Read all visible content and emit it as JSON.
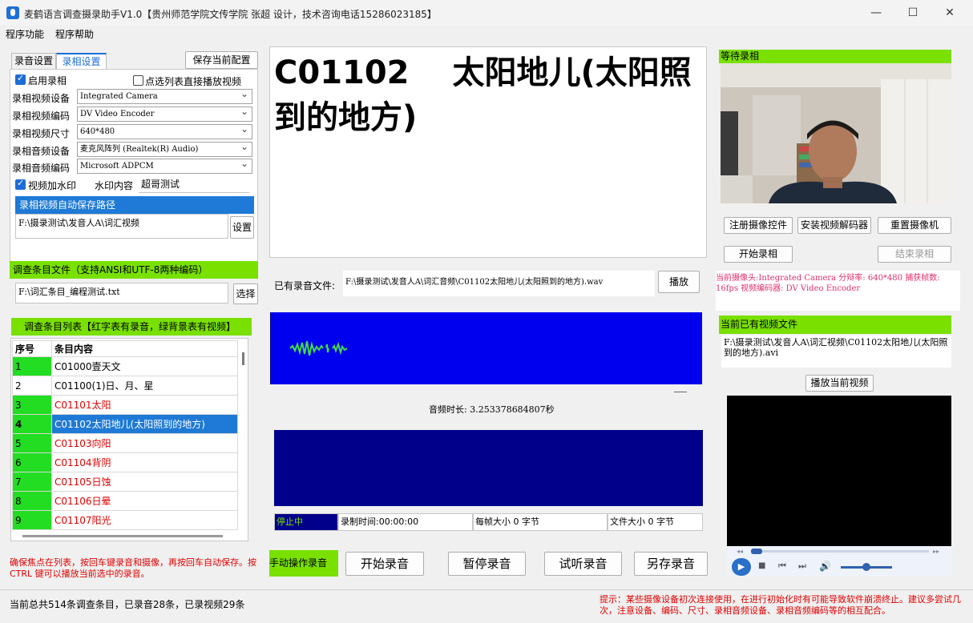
{
  "window": {
    "title": "麦鹤语言调查摄录助手V1.0【贵州师范学院文传学院 张超 设计，技术咨询电话15286023185】",
    "minimize": "—",
    "maximize": "☐",
    "close": "✕"
  },
  "menu": [
    "程序功能",
    "程序帮助"
  ],
  "left": {
    "tabs": [
      "录音设置",
      "录相设置"
    ],
    "active_tab": "录相设置",
    "save_config": "保存当前配置",
    "enable_video": "启用录相",
    "click_play": "点选列表直接播放视频",
    "settings": [
      {
        "label": "录相视频设备",
        "value": "Integrated Camera"
      },
      {
        "label": "录相视频编码",
        "value": "DV Video Encoder"
      },
      {
        "label": "录相视频尺寸",
        "value": "640*480"
      },
      {
        "label": "录相音频设备",
        "value": "麦克风阵列 (Realtek(R) Audio)"
      },
      {
        "label": "录相音频编码",
        "value": "Microsoft ADPCM"
      }
    ],
    "watermark_check": "视频加水印",
    "watermark_label": "水印内容",
    "watermark_value": "超哥测试",
    "save_path_header": "录相视频自动保存路径",
    "save_path": "F:\\摄录测试\\发音人A\\词汇视频",
    "set_button": "设置",
    "survey_file_header": "调查条目文件（支持ANSI和UTF-8两种编码）",
    "survey_file": "F:\\词汇条目_编程测试.txt",
    "choose_button": "选择",
    "list_header": "调查条目列表【红字表有录音，绿背景表有视频】",
    "columns": [
      "序号",
      "条目内容"
    ],
    "rows": [
      {
        "no": "1",
        "text": "C01000壹天文",
        "audio": false,
        "video": true
      },
      {
        "no": "2",
        "text": "C01100(1)日、月、星",
        "audio": false,
        "video": false
      },
      {
        "no": "3",
        "text": "C01101太阳",
        "audio": true,
        "video": true
      },
      {
        "no": "4",
        "text": "C01102太阳地儿(太阳照到的地方)",
        "audio": true,
        "video": true,
        "selected": true
      },
      {
        "no": "5",
        "text": "C01103向阳",
        "audio": true,
        "video": true
      },
      {
        "no": "6",
        "text": "C01104背阴",
        "audio": true,
        "video": true
      },
      {
        "no": "7",
        "text": "C01105日蚀",
        "audio": true,
        "video": true
      },
      {
        "no": "8",
        "text": "C01106日晕",
        "audio": true,
        "video": true
      },
      {
        "no": "9",
        "text": "C01107阳光",
        "audio": true,
        "video": true
      }
    ],
    "hint": "确保焦点在列表，按回车键录音和摄像，再按回车自动保存。按CTRL 键可以播放当前选中的录音。"
  },
  "center": {
    "word": "C01102　 太阳地儿(太阳照到的地方)",
    "audio_file_label": "已有录音文件:",
    "audio_file": "F:\\摄录测试\\发音人A\\词汇音频\\C01102太阳地儿(太阳照到的地方).wav",
    "play_button": "播放",
    "duration": "音频时长: 3.253378684807秒",
    "status": {
      "state": "停止中",
      "record_time": "录制时间:00:00:00",
      "frame_size": "每帧大小 0 字节",
      "file_size": "文件大小 0 字节"
    },
    "manual_label": "手动操作录音",
    "buttons": [
      "开始录音",
      "暂停录音",
      "试听录音",
      "另存录音"
    ]
  },
  "right": {
    "wait_label": "等待录相",
    "camera_buttons": [
      "注册摄像控件",
      "安装视频解码器",
      "重置摄像机"
    ],
    "start_record": "开始录相",
    "stop_record": "结束录相",
    "camera_info": "当前摄像头:Integrated Camera 分辩率: 640*480  捕获帧数: 16fps 视频编码器: DV Video Encoder",
    "video_file_header": "当前已有视频文件",
    "video_file": "F:\\摄录测试\\发音人A\\词汇视频\\C01102太阳地儿(太阳照到的地方).avi",
    "play_video": "播放当前视频"
  },
  "footer": {
    "summary": "当前总共514条调查条目，已录音28条，已录视频29条",
    "tip": "提示：某些摄像设备初次连接使用，在进行初始化时有可能导致软件崩溃终止。建议多尝试几次，注意设备、编码、尺寸、录相音频设备、录相音频编码等的相互配合。"
  },
  "colors": {
    "accent": "#1e7ad6",
    "green": "#79e000",
    "red": "#e00000",
    "wave_blue": "#0000ee",
    "wave_navy": "#00008b"
  }
}
